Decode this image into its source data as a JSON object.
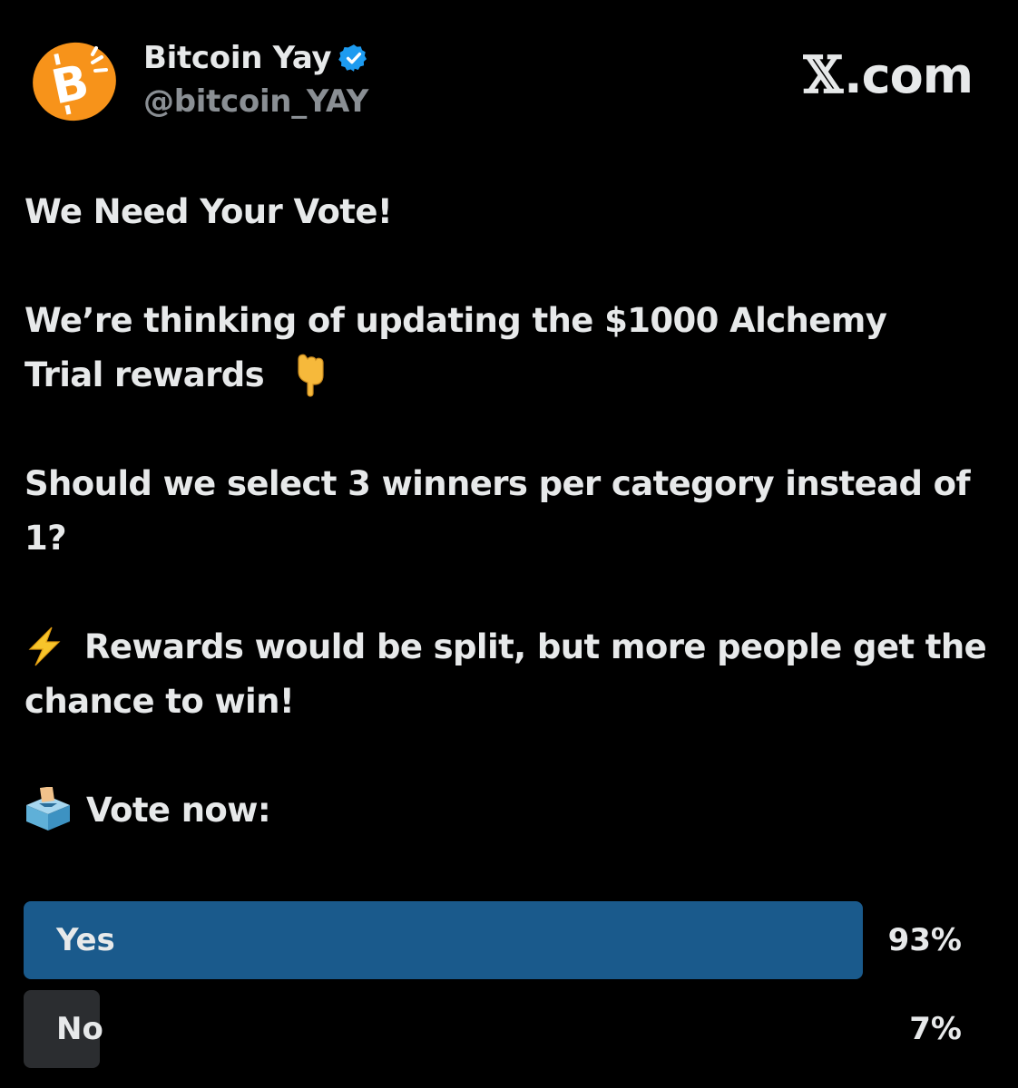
{
  "author": {
    "display_name": "Bitcoin Yay",
    "handle": "@bitcoin_YAY",
    "verified": true,
    "avatar_icon": "bitcoin-logo-icon",
    "avatar_color": "#f7931a"
  },
  "brand": {
    "x_glyph": "𝕏",
    "suffix": ".com"
  },
  "post": {
    "line1": "We Need Your Vote!",
    "line2a": "We’re thinking of updating the $1000 Alchemy",
    "line2b": "Trial rewards",
    "line2_emoji": "backhand-index-pointing-down-icon",
    "line3a": "Should we select 3 winners per category instead of",
    "line3b": "1?",
    "line4_emoji": "high-voltage-icon",
    "line4a": "Rewards would be split, but more people get the",
    "line4b": "chance to win!",
    "line5_emoji": "ballot-box-icon",
    "line5": "Vote now:"
  },
  "poll": {
    "options": [
      {
        "label": "Yes",
        "percent_text": "93%",
        "percent": 93,
        "leading": true
      },
      {
        "label": "No",
        "percent_text": "7%",
        "percent": 7,
        "leading": false
      }
    ],
    "leading_color": "#1a5a8c",
    "other_color": "#2b2d30"
  }
}
